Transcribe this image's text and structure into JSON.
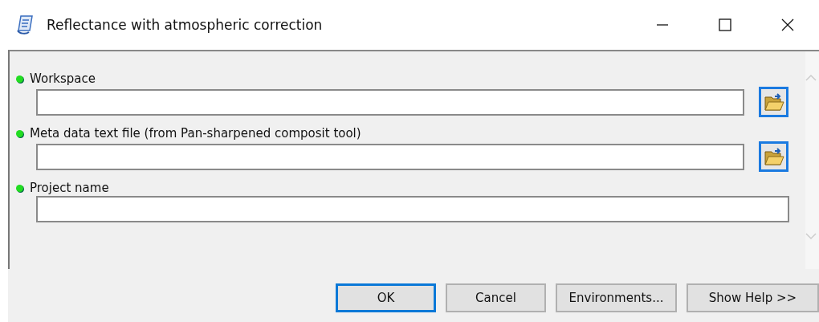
{
  "window": {
    "title": "Reflectance with atmospheric correction"
  },
  "parameters": [
    {
      "label": "Workspace",
      "kind": "folder",
      "required": true
    },
    {
      "label": "Meta data text file (from Pan-sharpened composit tool)",
      "kind": "folder",
      "required": true
    },
    {
      "label": "Project name",
      "kind": "text",
      "required": true
    }
  ],
  "buttons": [
    {
      "label": "OK",
      "default": true
    },
    {
      "label": "Cancel",
      "default": false
    },
    {
      "label": "Environments...",
      "default": false
    },
    {
      "label": "Show Help >>",
      "default": false
    }
  ]
}
